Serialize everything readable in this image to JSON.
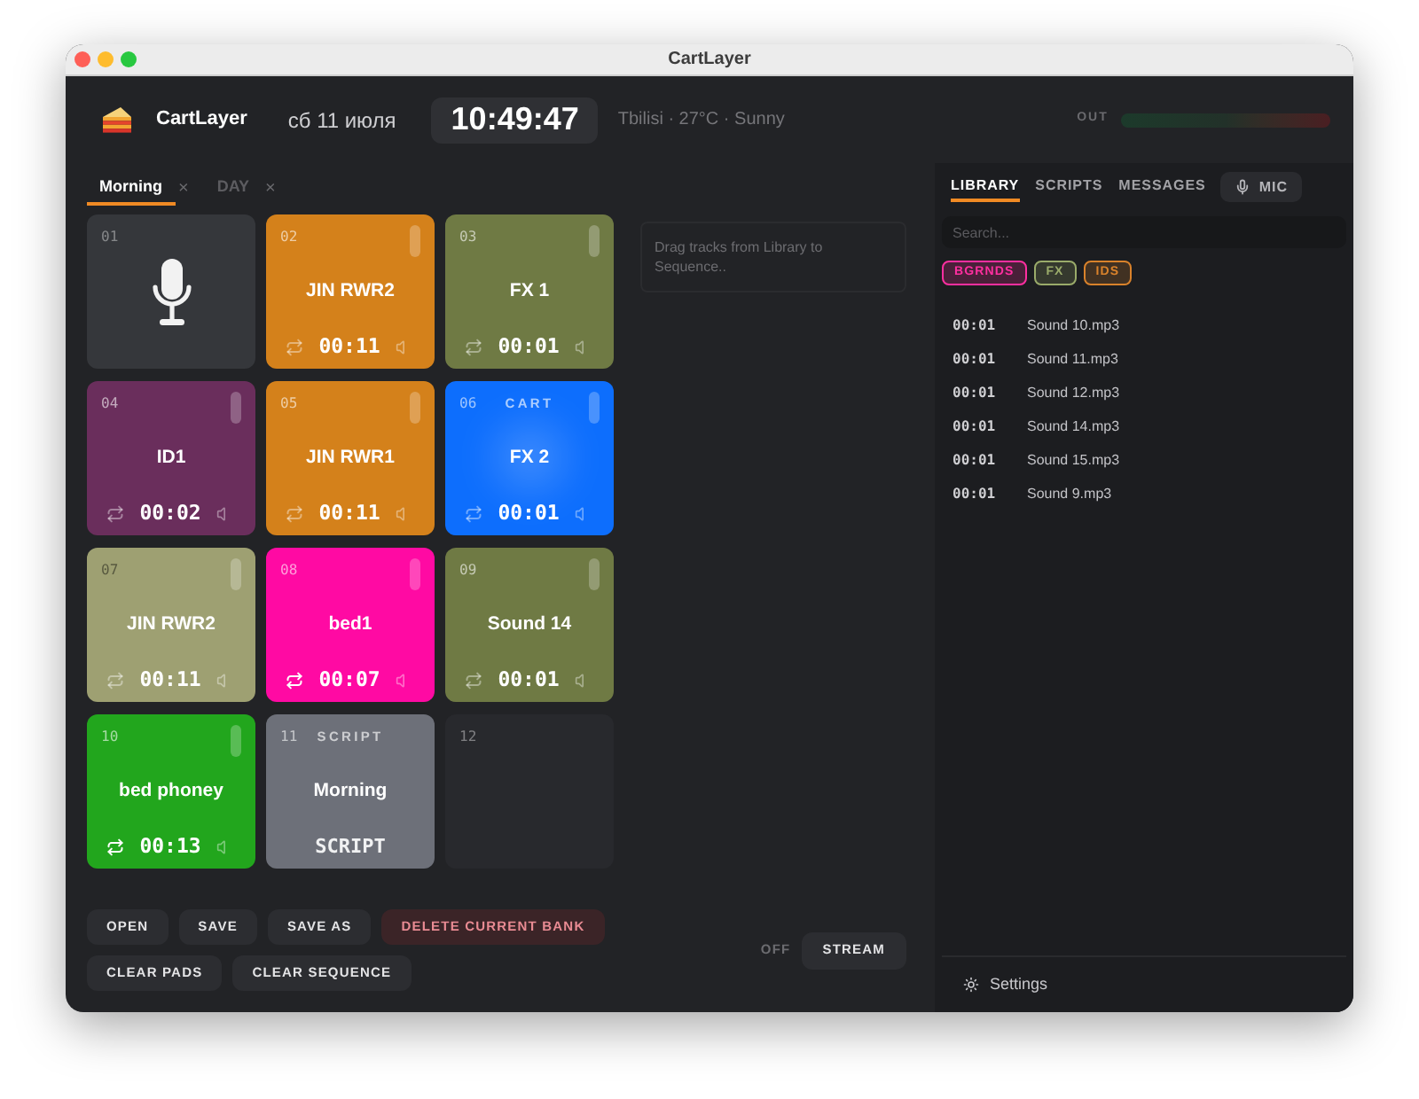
{
  "window": {
    "title": "CartLayer"
  },
  "header": {
    "app_name": "CartLayer",
    "date": "сб 11 июля",
    "clock": "10:49:47",
    "weather": "Tbilisi · 27°C · Sunny",
    "output_label": "OUT"
  },
  "bank_tabs": [
    {
      "label": "Morning",
      "selected": true,
      "close": "×"
    },
    {
      "label": "DAY",
      "selected": false,
      "close": "×"
    }
  ],
  "pads": [
    {
      "number": "01",
      "kind": "mic",
      "playing": false
    },
    {
      "number": "02",
      "kind": "audio",
      "color": "#d4811b",
      "name": "JIN RWR2",
      "duration": "00:11",
      "loop": false,
      "playing": false
    },
    {
      "number": "03",
      "kind": "audio",
      "color": "#6f7a44",
      "name": "FX 1",
      "duration": "00:01",
      "loop": false,
      "playing": false
    },
    {
      "number": "04",
      "kind": "audio",
      "color": "#6a2e5c",
      "name": "ID1",
      "duration": "00:02",
      "loop": false,
      "playing": false
    },
    {
      "number": "05",
      "kind": "audio",
      "color": "#d4811b",
      "name": "JIN RWR1",
      "duration": "00:11",
      "loop": false,
      "playing": false
    },
    {
      "number": "06",
      "kind": "audio",
      "color": "#0d6efd",
      "tag": "CART",
      "name": "FX 2",
      "duration": "00:01",
      "loop": false,
      "playing": true
    },
    {
      "number": "07",
      "kind": "audio",
      "color": "#9ea072",
      "name": "JIN RWR2",
      "duration": "00:11",
      "loop": false,
      "playing": false
    },
    {
      "number": "08",
      "kind": "audio",
      "color": "#ff0aa3",
      "name": "bed1",
      "duration": "00:07",
      "loop": true,
      "playing": false
    },
    {
      "number": "09",
      "kind": "audio",
      "color": "#6f7a44",
      "name": "Sound 14",
      "duration": "00:01",
      "loop": false,
      "playing": false
    },
    {
      "number": "10",
      "kind": "audio",
      "color": "#22a61d",
      "name": "bed phoney",
      "duration": "00:13",
      "loop": true,
      "playing": false
    },
    {
      "number": "11",
      "kind": "script",
      "color": "#6d7079",
      "tag": "SCRIPT",
      "name": "Morning",
      "footer": "SCRIPT",
      "playing": false
    },
    {
      "number": "12",
      "kind": "empty",
      "playing": false
    }
  ],
  "sequence": {
    "hint": "Drag tracks from Library to Sequence.."
  },
  "bank_actions": [
    [
      {
        "label": "OPEN",
        "kind": "plain"
      },
      {
        "label": "SAVE",
        "kind": "plain"
      },
      {
        "label": "SAVE AS",
        "kind": "plain"
      },
      {
        "label": "DELETE CURRENT BANK",
        "kind": "danger"
      }
    ],
    [
      {
        "label": "CLEAR PADS",
        "kind": "plain"
      },
      {
        "label": "CLEAR SEQUENCE",
        "kind": "plain"
      }
    ]
  ],
  "stream": {
    "status": "OFF",
    "button": "STREAM"
  },
  "library": {
    "tabs": [
      {
        "label": "LIBRARY",
        "selected": true
      },
      {
        "label": "SCRIPTS",
        "selected": false
      },
      {
        "label": "MESSAGES",
        "selected": false
      }
    ],
    "mic_button": "MIC",
    "search": {
      "placeholder": "Search..."
    },
    "filters": [
      {
        "label": "BGRNDS",
        "color": "#ff2fa0"
      },
      {
        "label": "FX",
        "color": "#9aab6a"
      },
      {
        "label": "IDS",
        "color": "#d9822b"
      }
    ],
    "tracks": [
      {
        "duration": "00:01",
        "name": "Sound 10.mp3"
      },
      {
        "duration": "00:01",
        "name": "Sound 11.mp3"
      },
      {
        "duration": "00:01",
        "name": "Sound 12.mp3"
      },
      {
        "duration": "00:01",
        "name": "Sound 14.mp3"
      },
      {
        "duration": "00:01",
        "name": "Sound 15.mp3"
      },
      {
        "duration": "00:01",
        "name": "Sound 9.mp3"
      }
    ]
  },
  "settings": {
    "label": "Settings"
  }
}
